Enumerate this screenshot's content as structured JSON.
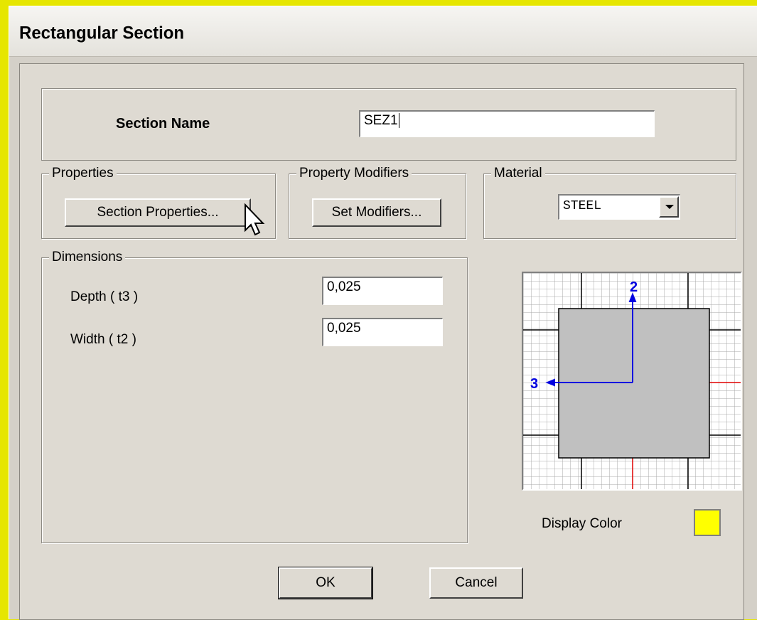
{
  "window": {
    "title": "Rectangular Section"
  },
  "section_name": {
    "label": "Section Name",
    "value": "SEZ1"
  },
  "properties": {
    "legend": "Properties",
    "button": "Section Properties..."
  },
  "modifiers": {
    "legend": "Property Modifiers",
    "button": "Set Modifiers..."
  },
  "material": {
    "legend": "Material",
    "selected": "STEEL"
  },
  "dimensions": {
    "legend": "Dimensions",
    "depth_label": "Depth  ( t3 )",
    "depth_value": "0,025",
    "width_label": "Width  ( t2 )",
    "width_value": "0,025"
  },
  "preview": {
    "axis2_label": "2",
    "axis3_label": "3"
  },
  "display_color": {
    "label": "Display Color",
    "color": "#ffff00"
  },
  "buttons": {
    "ok": "OK",
    "cancel": "Cancel"
  }
}
